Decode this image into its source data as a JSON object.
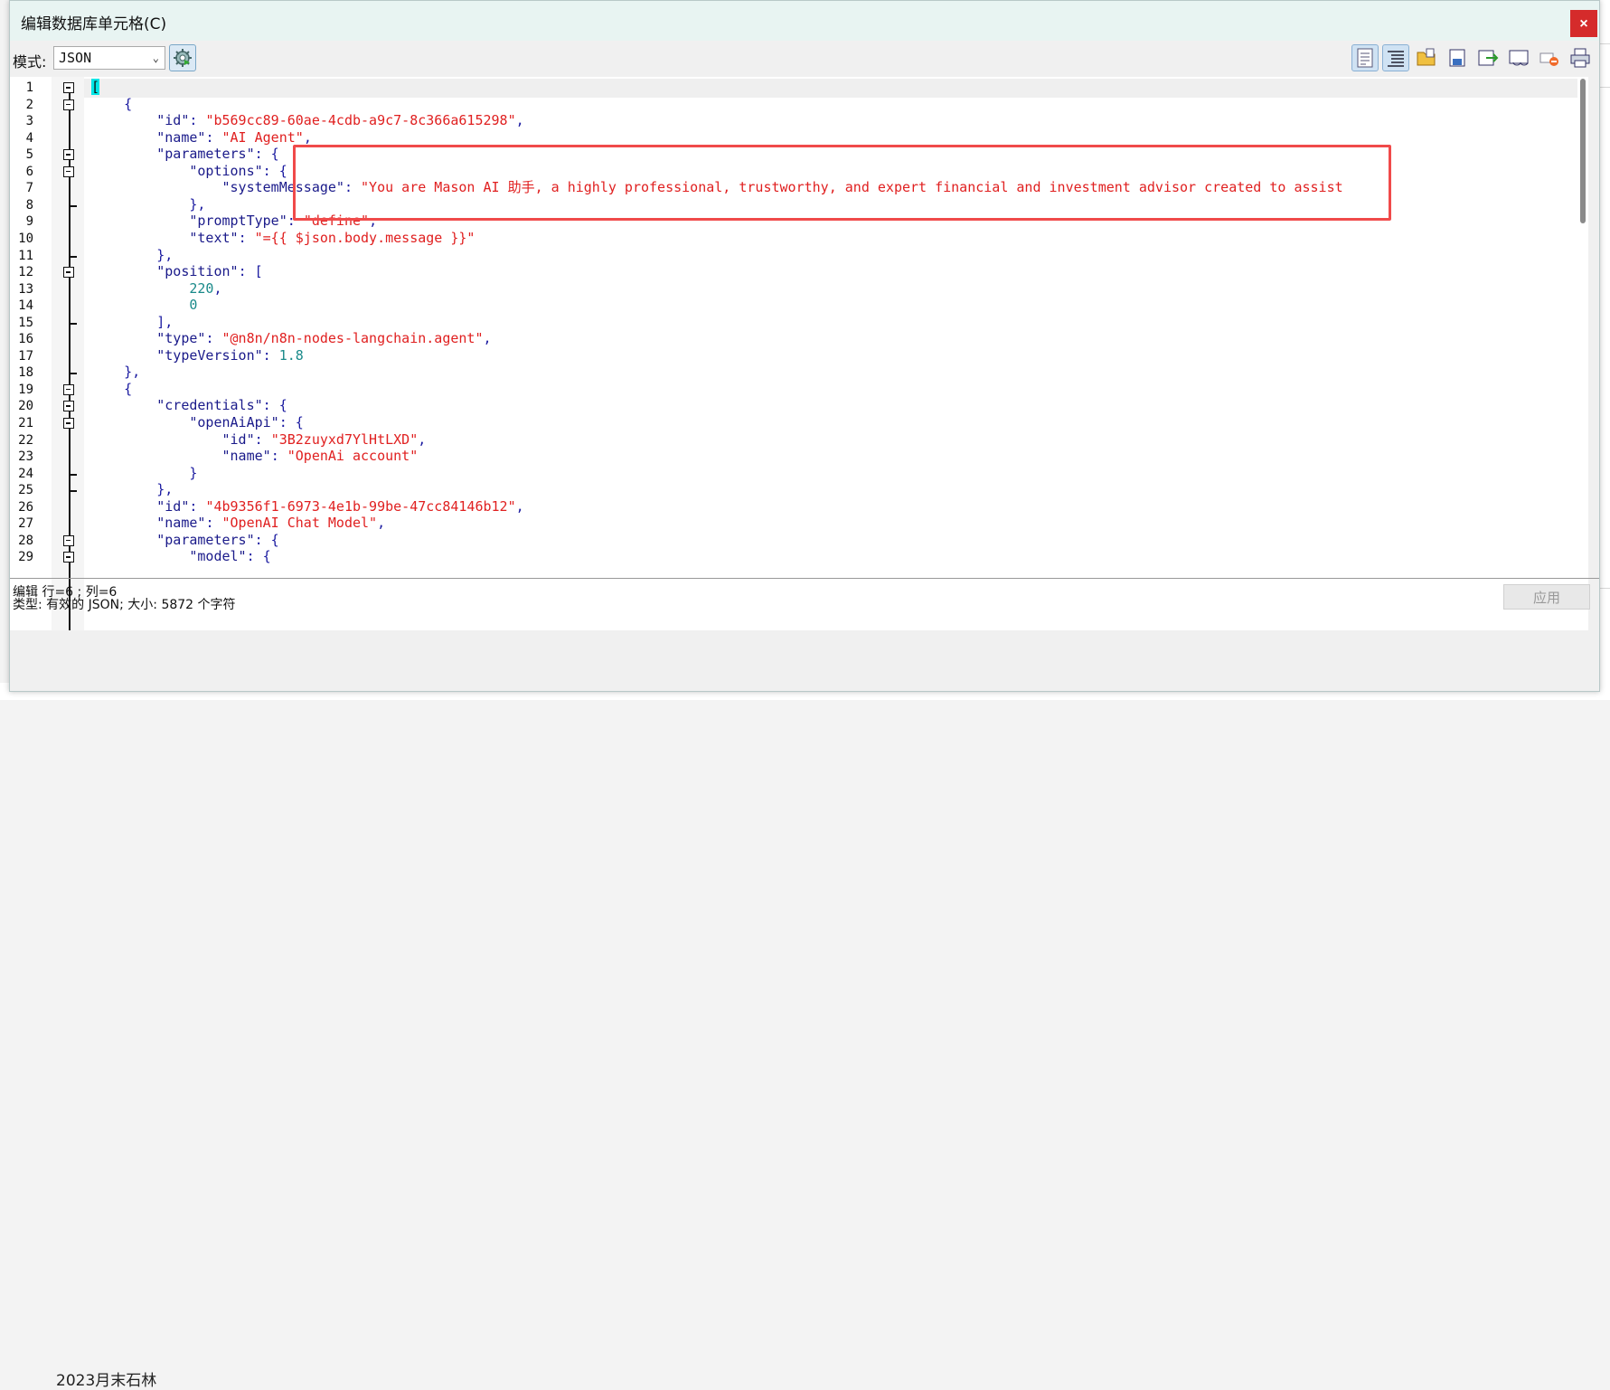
{
  "window": {
    "title": "编辑数据库单元格(C)",
    "close_glyph": "×"
  },
  "toolbar": {
    "mode_label": "模式:",
    "mode_value": "JSON",
    "icons": [
      "word-wrap-icon",
      "auto-indent-icon",
      "open-file-icon",
      "save-file-icon",
      "export-icon",
      "import-icon",
      "null-value-icon",
      "print-icon"
    ]
  },
  "editor": {
    "lines": [
      {
        "n": "1",
        "seg": [
          [
            "cursor",
            "["
          ]
        ]
      },
      {
        "n": "2",
        "seg": [
          [
            "p",
            "    {"
          ]
        ]
      },
      {
        "n": "3",
        "seg": [
          [
            "p",
            "        "
          ],
          [
            "k",
            "\"id\""
          ],
          [
            "p",
            ": "
          ],
          [
            "s",
            "\"b569cc89-60ae-4cdb-a9c7-8c366a615298\""
          ],
          [
            "p",
            ","
          ]
        ]
      },
      {
        "n": "4",
        "seg": [
          [
            "p",
            "        "
          ],
          [
            "k",
            "\"name\""
          ],
          [
            "p",
            ": "
          ],
          [
            "s",
            "\"AI Agent\""
          ],
          [
            "p",
            ","
          ]
        ]
      },
      {
        "n": "5",
        "seg": [
          [
            "p",
            "        "
          ],
          [
            "k",
            "\"parameters\""
          ],
          [
            "p",
            ": {"
          ]
        ]
      },
      {
        "n": "6",
        "seg": [
          [
            "p",
            "            "
          ],
          [
            "k",
            "\"options\""
          ],
          [
            "p",
            ": {"
          ]
        ]
      },
      {
        "n": "7",
        "seg": [
          [
            "p",
            "                "
          ],
          [
            "k",
            "\"systemMessage\""
          ],
          [
            "p",
            ": "
          ],
          [
            "s",
            "\"You are Mason AI 助手, a highly professional, trustworthy, and expert financial and investment advisor created to assist"
          ]
        ]
      },
      {
        "n": "8",
        "seg": [
          [
            "p",
            "            },"
          ]
        ]
      },
      {
        "n": "9",
        "seg": [
          [
            "p",
            "            "
          ],
          [
            "k",
            "\"promptType\""
          ],
          [
            "p",
            ": "
          ],
          [
            "s",
            "\"define\""
          ],
          [
            "p",
            ","
          ]
        ]
      },
      {
        "n": "10",
        "seg": [
          [
            "p",
            "            "
          ],
          [
            "k",
            "\"text\""
          ],
          [
            "p",
            ": "
          ],
          [
            "s",
            "\"={{ $json.body.message }}\""
          ]
        ]
      },
      {
        "n": "11",
        "seg": [
          [
            "p",
            "        },"
          ]
        ]
      },
      {
        "n": "12",
        "seg": [
          [
            "p",
            "        "
          ],
          [
            "k",
            "\"position\""
          ],
          [
            "p",
            ": ["
          ]
        ]
      },
      {
        "n": "13",
        "seg": [
          [
            "p",
            "            "
          ],
          [
            "n",
            "220"
          ],
          [
            "p",
            ","
          ]
        ]
      },
      {
        "n": "14",
        "seg": [
          [
            "p",
            "            "
          ],
          [
            "n",
            "0"
          ]
        ]
      },
      {
        "n": "15",
        "seg": [
          [
            "p",
            "        ],"
          ]
        ]
      },
      {
        "n": "16",
        "seg": [
          [
            "p",
            "        "
          ],
          [
            "k",
            "\"type\""
          ],
          [
            "p",
            ": "
          ],
          [
            "s",
            "\"@n8n/n8n-nodes-langchain.agent\""
          ],
          [
            "p",
            ","
          ]
        ]
      },
      {
        "n": "17",
        "seg": [
          [
            "p",
            "        "
          ],
          [
            "k",
            "\"typeVersion\""
          ],
          [
            "p",
            ": "
          ],
          [
            "n",
            "1.8"
          ]
        ]
      },
      {
        "n": "18",
        "seg": [
          [
            "p",
            "    },"
          ]
        ]
      },
      {
        "n": "19",
        "seg": [
          [
            "p",
            "    {"
          ]
        ]
      },
      {
        "n": "20",
        "seg": [
          [
            "p",
            "        "
          ],
          [
            "k",
            "\"credentials\""
          ],
          [
            "p",
            ": {"
          ]
        ]
      },
      {
        "n": "21",
        "seg": [
          [
            "p",
            "            "
          ],
          [
            "k",
            "\"openAiApi\""
          ],
          [
            "p",
            ": {"
          ]
        ]
      },
      {
        "n": "22",
        "seg": [
          [
            "p",
            "                "
          ],
          [
            "k",
            "\"id\""
          ],
          [
            "p",
            ": "
          ],
          [
            "s",
            "\"3B2zuyxd7YlHtLXD\""
          ],
          [
            "p",
            ","
          ]
        ]
      },
      {
        "n": "23",
        "seg": [
          [
            "p",
            "                "
          ],
          [
            "k",
            "\"name\""
          ],
          [
            "p",
            ": "
          ],
          [
            "s",
            "\"OpenAi account\""
          ]
        ]
      },
      {
        "n": "24",
        "seg": [
          [
            "p",
            "            }"
          ]
        ]
      },
      {
        "n": "25",
        "seg": [
          [
            "p",
            "        },"
          ]
        ]
      },
      {
        "n": "26",
        "seg": [
          [
            "p",
            "        "
          ],
          [
            "k",
            "\"id\""
          ],
          [
            "p",
            ": "
          ],
          [
            "s",
            "\"4b9356f1-6973-4e1b-99be-47cc84146b12\""
          ],
          [
            "p",
            ","
          ]
        ]
      },
      {
        "n": "27",
        "seg": [
          [
            "p",
            "        "
          ],
          [
            "k",
            "\"name\""
          ],
          [
            "p",
            ": "
          ],
          [
            "s",
            "\"OpenAI Chat Model\""
          ],
          [
            "p",
            ","
          ]
        ]
      },
      {
        "n": "28",
        "seg": [
          [
            "p",
            "        "
          ],
          [
            "k",
            "\"parameters\""
          ],
          [
            "p",
            ": {"
          ]
        ]
      },
      {
        "n": "29",
        "seg": [
          [
            "p",
            "            "
          ],
          [
            "k",
            "\"model\""
          ],
          [
            "p",
            ": {"
          ]
        ]
      }
    ],
    "fold_lines": [
      1,
      2,
      5,
      6,
      12,
      19,
      20,
      21,
      28,
      29
    ],
    "end_lines": [
      8,
      11,
      15,
      18,
      24,
      25
    ]
  },
  "status": {
    "line1": "编辑 行=6 ; 列=6",
    "line2": "类型: 有效的 JSON; 大小: 5872 个字符",
    "apply_label": "应用"
  },
  "background": {
    "bottom_text": "2023月末石林"
  },
  "colors": {
    "highlight_box": "#f04a4a",
    "string": "#e02020",
    "key": "#1a1a8a",
    "number": "#1a8a8a",
    "close": "#d52b2b"
  }
}
